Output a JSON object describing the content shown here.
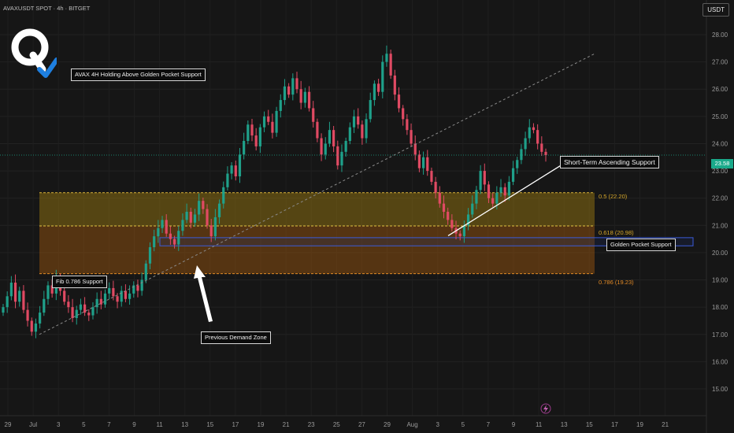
{
  "header": {
    "symbol": "AVAXUSDT SPOT · 4h · BITGET",
    "currency": "USDT"
  },
  "colors": {
    "background": "#161616",
    "up": "#1fa08a",
    "down": "#e04a63",
    "zone_gold": "#8a6d12",
    "zone_orange": "#8a4e10",
    "golden_pocket_border": "#3b5bd9",
    "price_badge": "#1aa98a"
  },
  "annotations": {
    "title_box": "AVAX 4H Holding Above Golden Pocket Support",
    "fib_0786_support": "Fib 0.786 Support",
    "previous_demand": "Previous Demand Zone",
    "ascending_support": "Short-Term Ascending Support",
    "golden_pocket": "Golden Pocket Support"
  },
  "fib_levels": [
    {
      "label": "0.5 (22.20)",
      "value": 22.2
    },
    {
      "label": "0.618 (20.98)",
      "value": 20.98
    },
    {
      "label": "0.786 (19.23)",
      "value": 19.23
    }
  ],
  "last_price": "23.58",
  "logo_icon": "q-checkmark-logo",
  "chart_data": {
    "type": "candlestick",
    "title": "",
    "ylim": [
      15.0,
      28.4
    ],
    "y_ticks": [
      "15.00",
      "16.00",
      "17.00",
      "18.00",
      "19.00",
      "20.00",
      "21.00",
      "22.00",
      "23.00",
      "24.00",
      "25.00",
      "26.00",
      "27.00",
      "28.00"
    ],
    "x_ticks": [
      "29",
      "Jul",
      "3",
      "5",
      "7",
      "9",
      "11",
      "13",
      "15",
      "17",
      "19",
      "21",
      "23",
      "25",
      "27",
      "29",
      "Aug",
      "3",
      "5",
      "7",
      "9",
      "11",
      "13",
      "15",
      "17",
      "19",
      "21"
    ],
    "closes": [
      18.0,
      18.4,
      18.9,
      18.2,
      18.6,
      17.9,
      17.5,
      17.1,
      17.4,
      17.8,
      18.3,
      18.8,
      18.5,
      19.1,
      18.6,
      18.2,
      18.0,
      17.6,
      17.9,
      18.1,
      17.8,
      17.7,
      18.0,
      18.3,
      18.1,
      18.5,
      18.7,
      18.4,
      18.2,
      18.6,
      18.3,
      18.5,
      18.8,
      18.6,
      19.0,
      19.6,
      20.2,
      20.6,
      20.9,
      21.2,
      20.7,
      20.5,
      20.3,
      20.8,
      21.2,
      21.5,
      21.1,
      21.4,
      21.9,
      21.6,
      21.0,
      20.6,
      21.3,
      21.8,
      22.4,
      22.9,
      23.2,
      22.8,
      23.6,
      24.1,
      24.7,
      24.3,
      23.9,
      24.6,
      25.0,
      24.8,
      24.4,
      25.2,
      25.6,
      26.1,
      25.8,
      26.4,
      26.0,
      25.5,
      25.9,
      25.3,
      24.8,
      24.2,
      23.6,
      24.0,
      24.5,
      23.9,
      23.2,
      23.7,
      24.1,
      24.6,
      25.0,
      24.7,
      24.2,
      24.9,
      25.6,
      26.2,
      25.9,
      27.0,
      27.3,
      26.5,
      25.8,
      25.3,
      24.9,
      24.5,
      24.0,
      23.6,
      23.1,
      23.5,
      23.0,
      22.6,
      22.2,
      21.8,
      21.5,
      21.2,
      20.9,
      20.7,
      20.6,
      21.0,
      21.4,
      21.8,
      22.3,
      23.0,
      22.5,
      22.0,
      21.8,
      22.2,
      22.4,
      22.1,
      22.6,
      23.1,
      23.4,
      23.8,
      24.2,
      24.6,
      24.5,
      24.0,
      23.7,
      23.58
    ],
    "fib_values": [
      22.2,
      20.98,
      19.23
    ],
    "golden_pocket_zone": [
      20.25,
      20.55
    ]
  }
}
